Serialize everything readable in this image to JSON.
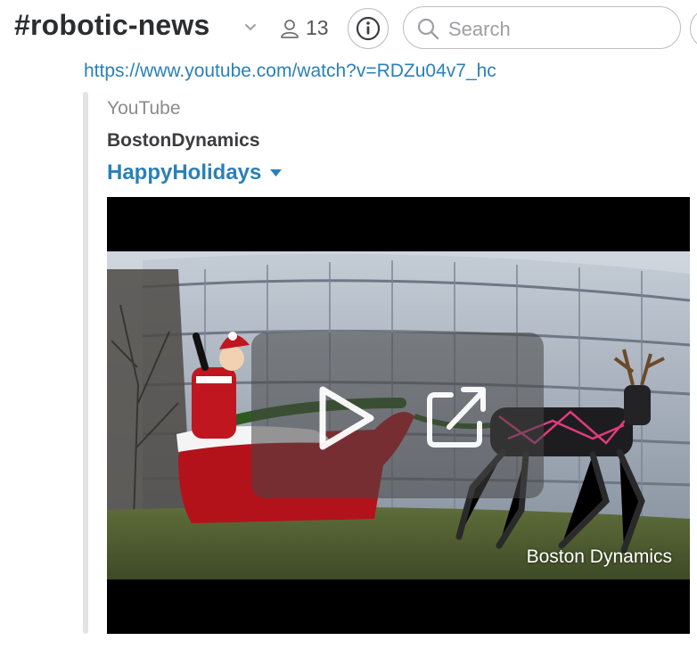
{
  "header": {
    "channel_name": "#robotic-news",
    "member_count": "13",
    "search_placeholder": "Search",
    "icons": [
      "chevron-down-icon",
      "member-icon",
      "info-icon",
      "search-icon"
    ]
  },
  "message": {
    "link_url": "https://www.youtube.com/watch?v=RDZu04v7_hc",
    "attachment": {
      "provider": "YouTube",
      "author": "BostonDynamics",
      "title": "HappyHolidays",
      "video": {
        "watermark": "Boston Dynamics",
        "controls": [
          "play-icon",
          "open-external-icon"
        ]
      }
    }
  },
  "colors": {
    "link": "#2a80b9",
    "channel_text": "#2c2d30",
    "muted": "#8b8b90",
    "attachment_bar": "#e3e3e3"
  }
}
